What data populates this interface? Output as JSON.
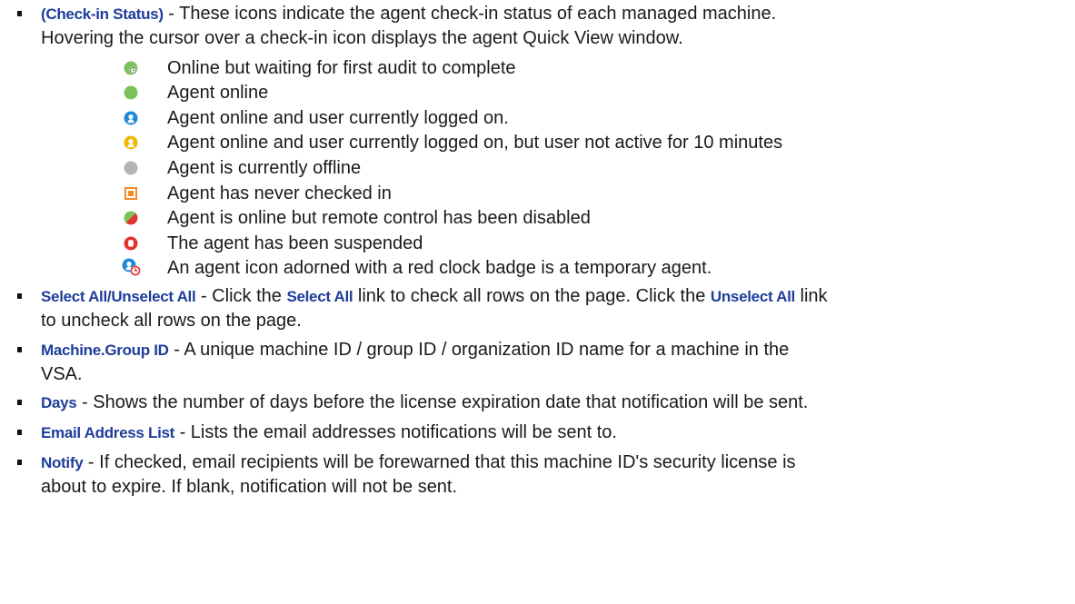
{
  "intro": {
    "term": "(Check-in Status)",
    "line1": " - These icons indicate the agent check-in status of each managed machine.",
    "line2": "Hovering the cursor over a check-in icon displays the agent Quick View window."
  },
  "statuses": [
    {
      "icon": "clock-green-icon",
      "label": "Online but waiting for first audit to complete"
    },
    {
      "icon": "green-dot-icon",
      "label": "Agent online"
    },
    {
      "icon": "user-blue-icon",
      "label": "Agent online and user currently logged on."
    },
    {
      "icon": "user-yellow-icon",
      "label": "Agent online and user currently logged on, but user not active for 10 minutes"
    },
    {
      "icon": "gray-dot-icon",
      "label": "Agent is currently offline"
    },
    {
      "icon": "orange-square-icon",
      "label": "Agent has never checked in"
    },
    {
      "icon": "half-red-green-icon",
      "label": "Agent is online but remote control has been disabled"
    },
    {
      "icon": "suspended-hand-icon",
      "label": "The agent has been suspended"
    },
    {
      "icon": "temporary-agent-icon",
      "label": " An agent icon adorned with a red clock badge is a temporary agent."
    }
  ],
  "items": {
    "select_all": {
      "term": "Select All/Unselect All",
      "t1": " - Click the ",
      "link1": "Select All",
      "t2": " link to check all rows on the page. Click the ",
      "link2": "Unselect All",
      "t3": " link",
      "line2": "to uncheck all rows on the page."
    },
    "machine_group": {
      "term": "Machine.Group ID",
      "t1": " - A unique machine ID / group ID / organization ID name for a machine in the",
      "line2": "VSA."
    },
    "days": {
      "term": "Days",
      "t1": " - Shows the number of days before the license expiration date that notification will be sent."
    },
    "email_list": {
      "term": "Email Address List",
      "t1": " - Lists the email addresses notifications will be sent to."
    },
    "notify": {
      "term": "Notify",
      "t1": " - If checked, email recipients will be forewarned that this machine ID's security license is",
      "line2": "about to expire. If blank, notification will not be sent."
    }
  },
  "colors": {
    "term_blue": "#1f3d9a",
    "green": "#7cc15a",
    "blue": "#1e88d8",
    "yellow": "#f2b705",
    "gray": "#b4b4b4",
    "orange": "#f08a24",
    "red": "#e5322d"
  }
}
